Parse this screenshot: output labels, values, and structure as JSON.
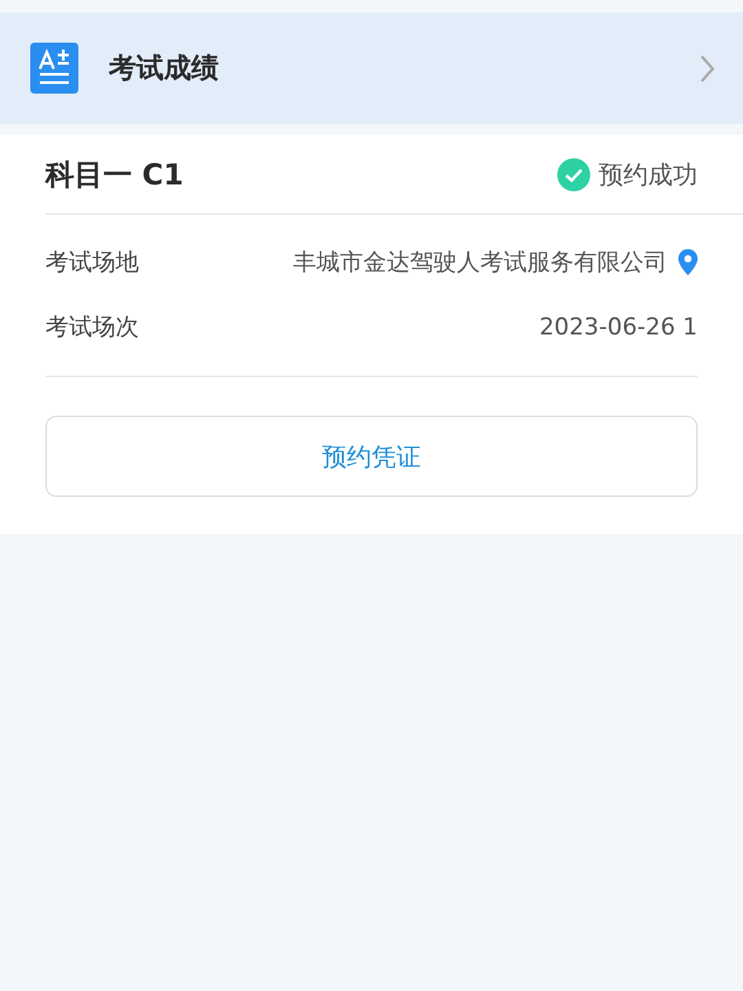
{
  "header": {
    "title": "考试成绩"
  },
  "card": {
    "subject": "科目一 C1",
    "status": "预约成功",
    "rows": [
      {
        "kind": "location",
        "label": "考试场地",
        "value": "丰城市金达驾驶人考试服务有限公司"
      },
      {
        "kind": "plain",
        "label": "考试场次",
        "value": "2023-06-26 1"
      }
    ],
    "button": "预约凭证"
  }
}
